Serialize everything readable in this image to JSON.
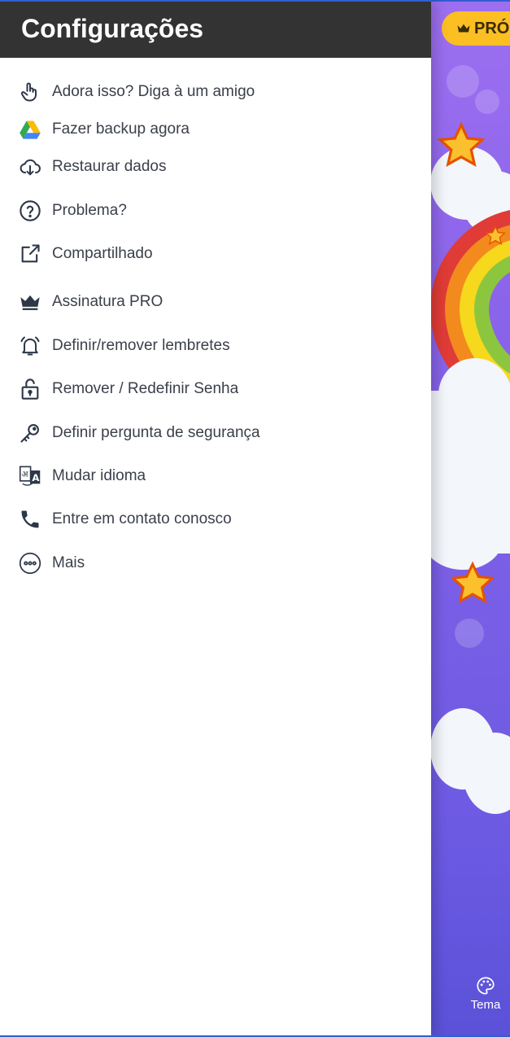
{
  "drawer": {
    "title": "Configurações",
    "items": [
      {
        "label": "Adora isso? Diga à um amigo",
        "icon": "hand-pointer-icon"
      },
      {
        "label": "Fazer backup agora",
        "icon": "google-drive-icon"
      },
      {
        "label": "Restaurar dados",
        "icon": "cloud-download-icon"
      },
      {
        "label": "Problema?",
        "icon": "question-circle-icon"
      },
      {
        "label": "Compartilhado",
        "icon": "share-icon"
      },
      {
        "label": "Assinatura PRO",
        "icon": "crown-icon"
      },
      {
        "label": "Definir/remover lembretes",
        "icon": "alarm-bell-icon"
      },
      {
        "label": "Remover / Redefinir Senha",
        "icon": "lock-icon"
      },
      {
        "label": "Definir pergunta de segurança",
        "icon": "key-icon"
      },
      {
        "label": "Mudar idioma",
        "icon": "translate-icon"
      },
      {
        "label": "Entre em contato conosco",
        "icon": "phone-icon"
      },
      {
        "label": "Mais",
        "icon": "more-circle-icon"
      }
    ]
  },
  "background_app": {
    "pro_button_label": "PRÓ",
    "theme_button_label": "Tema"
  },
  "colors": {
    "header_bg": "#333333",
    "icon_color": "#2d3748",
    "pro_yellow": "#fbbf24",
    "app_purple": "#8a64ea"
  }
}
